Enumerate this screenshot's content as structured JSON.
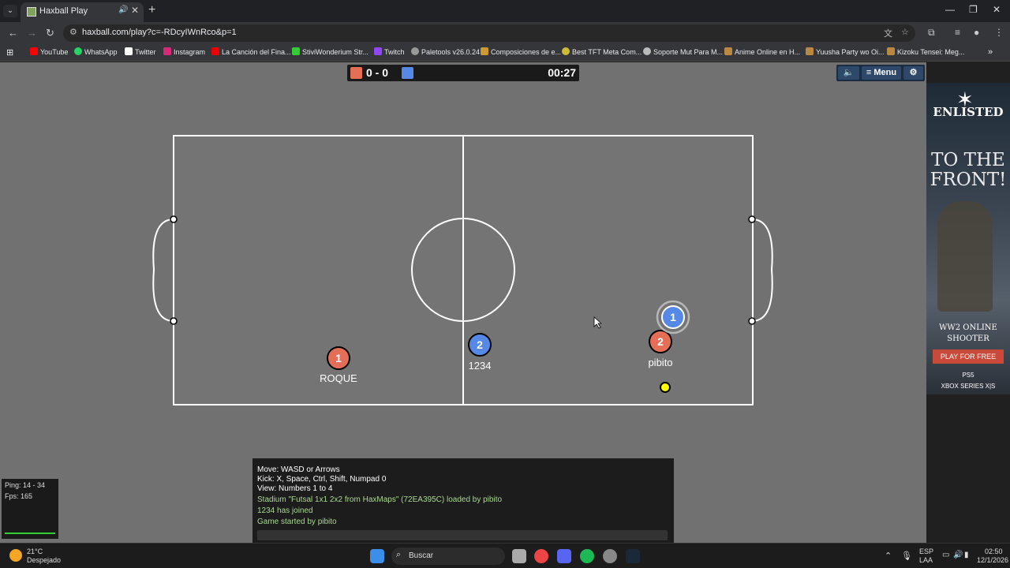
{
  "browser": {
    "tab_title": "Haxball Play",
    "url": "haxball.com/play?c=-RDcyIWnRco&p=1",
    "bookmarks": [
      "YouTube",
      "WhatsApp",
      "Twitter",
      "Instagram",
      "La Canción del Fina...",
      "StiviWonderium Str...",
      "Twitch",
      "Paletools v26.0.24",
      "Composiciones de e...",
      "Best TFT Meta Com...",
      "Soporte Mut Para M...",
      "Anime Online en H...",
      "Yuusha Party wo Oi...",
      "Kizoku Tensei: Meg..."
    ]
  },
  "scoreboard": {
    "score": "0 - 0",
    "timer": "00:27",
    "red_color": "#e56e56",
    "blue_color": "#5689e5"
  },
  "menu": {
    "sound_icon": "speaker-icon",
    "menu_label": "≡ Menu",
    "settings_icon": "gear-icon"
  },
  "players": [
    {
      "team": "red",
      "number": "1",
      "name": "ROQUE"
    },
    {
      "team": "blue",
      "number": "2",
      "name": "1234"
    },
    {
      "team": "red",
      "number": "2",
      "name": "pibito"
    },
    {
      "team": "blue",
      "number": "1",
      "name": ""
    }
  ],
  "ball": {
    "color": "#ffff00"
  },
  "chat": {
    "lines": [
      {
        "text": "Move: WASD or Arrows",
        "color": "#ffffff"
      },
      {
        "text": "Kick: X, Space, Ctrl, Shift, Numpad 0",
        "color": "#ffffff"
      },
      {
        "text": "View: Numbers 1 to 4",
        "color": "#ffffff"
      },
      {
        "text": "Stadium \"Futsal 1x1 2x2 from HaxMaps\" (72EA395C) loaded by pibito",
        "color": "#a8d98f"
      },
      {
        "text": "1234 has joined",
        "color": "#a8d98f"
      },
      {
        "text": "Game started by pibito",
        "color": "#a8d98f"
      }
    ]
  },
  "stats": {
    "ping": "Ping: 14 - 34",
    "fps": "Fps: 165"
  },
  "ad": {
    "logo": "ENLISTED",
    "headline": "TO THE FRONT!",
    "subline1": "WW2 ONLINE",
    "subline2": "SHOOTER",
    "cta": "PLAY FOR FREE",
    "platform1": "PS5",
    "platform2": "XBOX SERIES X|S"
  },
  "taskbar": {
    "weather_temp": "21°C",
    "weather_desc": "Despejado",
    "search_label": "Buscar",
    "lang1": "ESP",
    "lang2": "LAA",
    "time": "02:50",
    "date": "12/1/2026"
  }
}
